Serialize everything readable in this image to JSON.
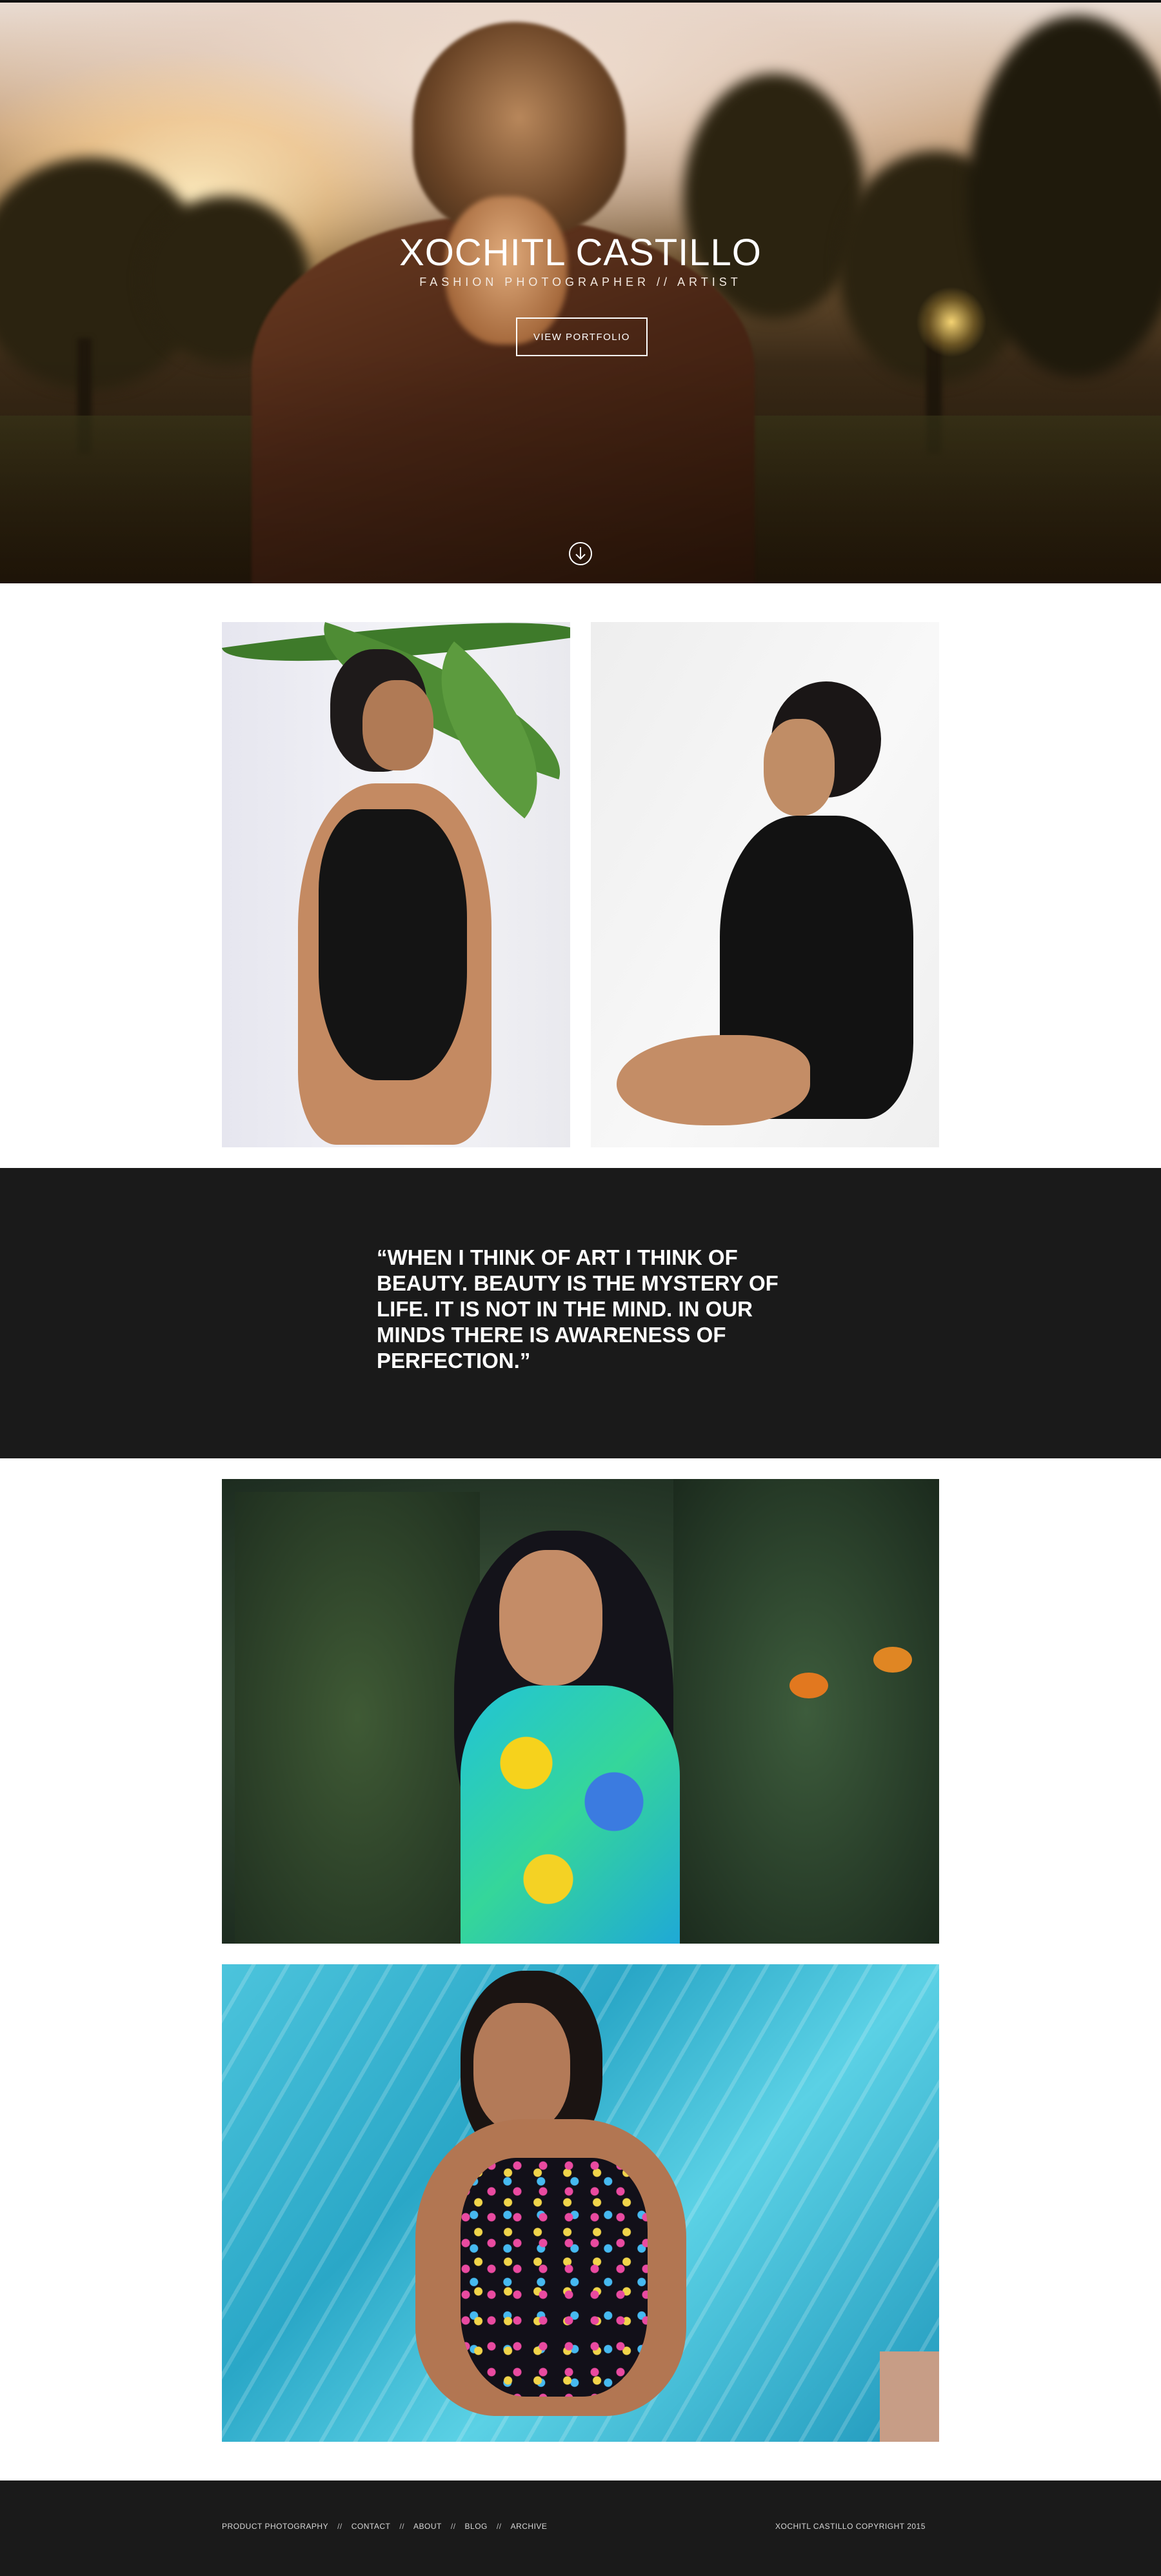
{
  "hero": {
    "title": "XOCHITL CASTILLO",
    "subtitle": "FASHION PHOTOGRAPHER // ARTIST",
    "cta_label": "VIEW PORTFOLIO",
    "scroll_icon": "arrow-down-circle-icon"
  },
  "quote": {
    "text": "“WHEN I THINK OF ART I THINK OF BEAUTY. BEAUTY IS THE MYSTERY OF LIFE. IT IS NOT IN THE MIND. IN OUR MINDS THERE IS AWARENESS OF PERFECTION.”"
  },
  "footer": {
    "nav": [
      {
        "label": "PRODUCT PHOTOGRAPHY"
      },
      {
        "label": "CONTACT"
      },
      {
        "label": "ABOUT"
      },
      {
        "label": "BLOG"
      },
      {
        "label": "ARCHIVE"
      }
    ],
    "separator": "//",
    "copyright": "XOCHITL CASTILLO COPYRIGHT 2015"
  },
  "colors": {
    "dark_band": "#1a1a1a",
    "background": "#ffffff",
    "text_light": "#ffffff"
  }
}
